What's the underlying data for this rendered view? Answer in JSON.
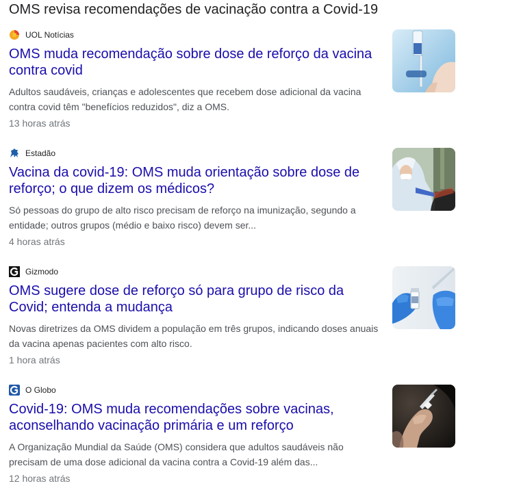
{
  "heading": "OMS revisa recomendações de vacinação contra a Covid-19",
  "stories": [
    {
      "source": "UOL Notícias",
      "source_icon": "uol-logo-icon",
      "title": "OMS muda recomendação sobre dose de reforço da vacina contra covid",
      "snippet": "Adultos saudáveis, crianças e adolescentes que recebem dose adicional da vacina contra covid têm \"benefícios reduzidos\", diz a OMS.",
      "time": "13 horas atrás",
      "thumbnail": "syringe-vial-photo"
    },
    {
      "source": "Estadão",
      "source_icon": "estadao-logo-icon",
      "title": "Vacina da covid-19: OMS muda orientação sobre dose de reforço; o que dizem os médicos?",
      "snippet": "Só pessoas do grupo de alto risco precisam de reforço na imunização, segundo a entidade; outros grupos (médio e baixo risco) devem ser...",
      "time": "4 horas atrás",
      "thumbnail": "health-worker-vaccinating-photo"
    },
    {
      "source": "Gizmodo",
      "source_icon": "gizmodo-logo-icon",
      "title": "OMS sugere dose de reforço só para grupo de risco da Covid; entenda a mudança",
      "snippet": "Novas diretrizes da OMS dividem a população em três grupos, indicando doses anuais da vacina apenas pacientes com alto risco.",
      "time": "1 hora atrás",
      "thumbnail": "gloved-hands-vial-photo"
    },
    {
      "source": "O Globo",
      "source_icon": "oglobo-logo-icon",
      "title": "Covid-19: OMS muda recomendações sobre vacinas, aconselhando vacinação primária e um reforço",
      "snippet": "A Organização Mundial da Saúde (OMS) considera que adultos saudáveis não precisam de uma dose adicional da vacina contra a Covid-19 além das...",
      "time": "12 horas atrás",
      "thumbnail": "hand-holding-syringe-photo"
    }
  ],
  "colors": {
    "title_link": "#1a0dab",
    "snippet": "#4d5156",
    "meta": "#70757a",
    "heading": "#202124"
  }
}
